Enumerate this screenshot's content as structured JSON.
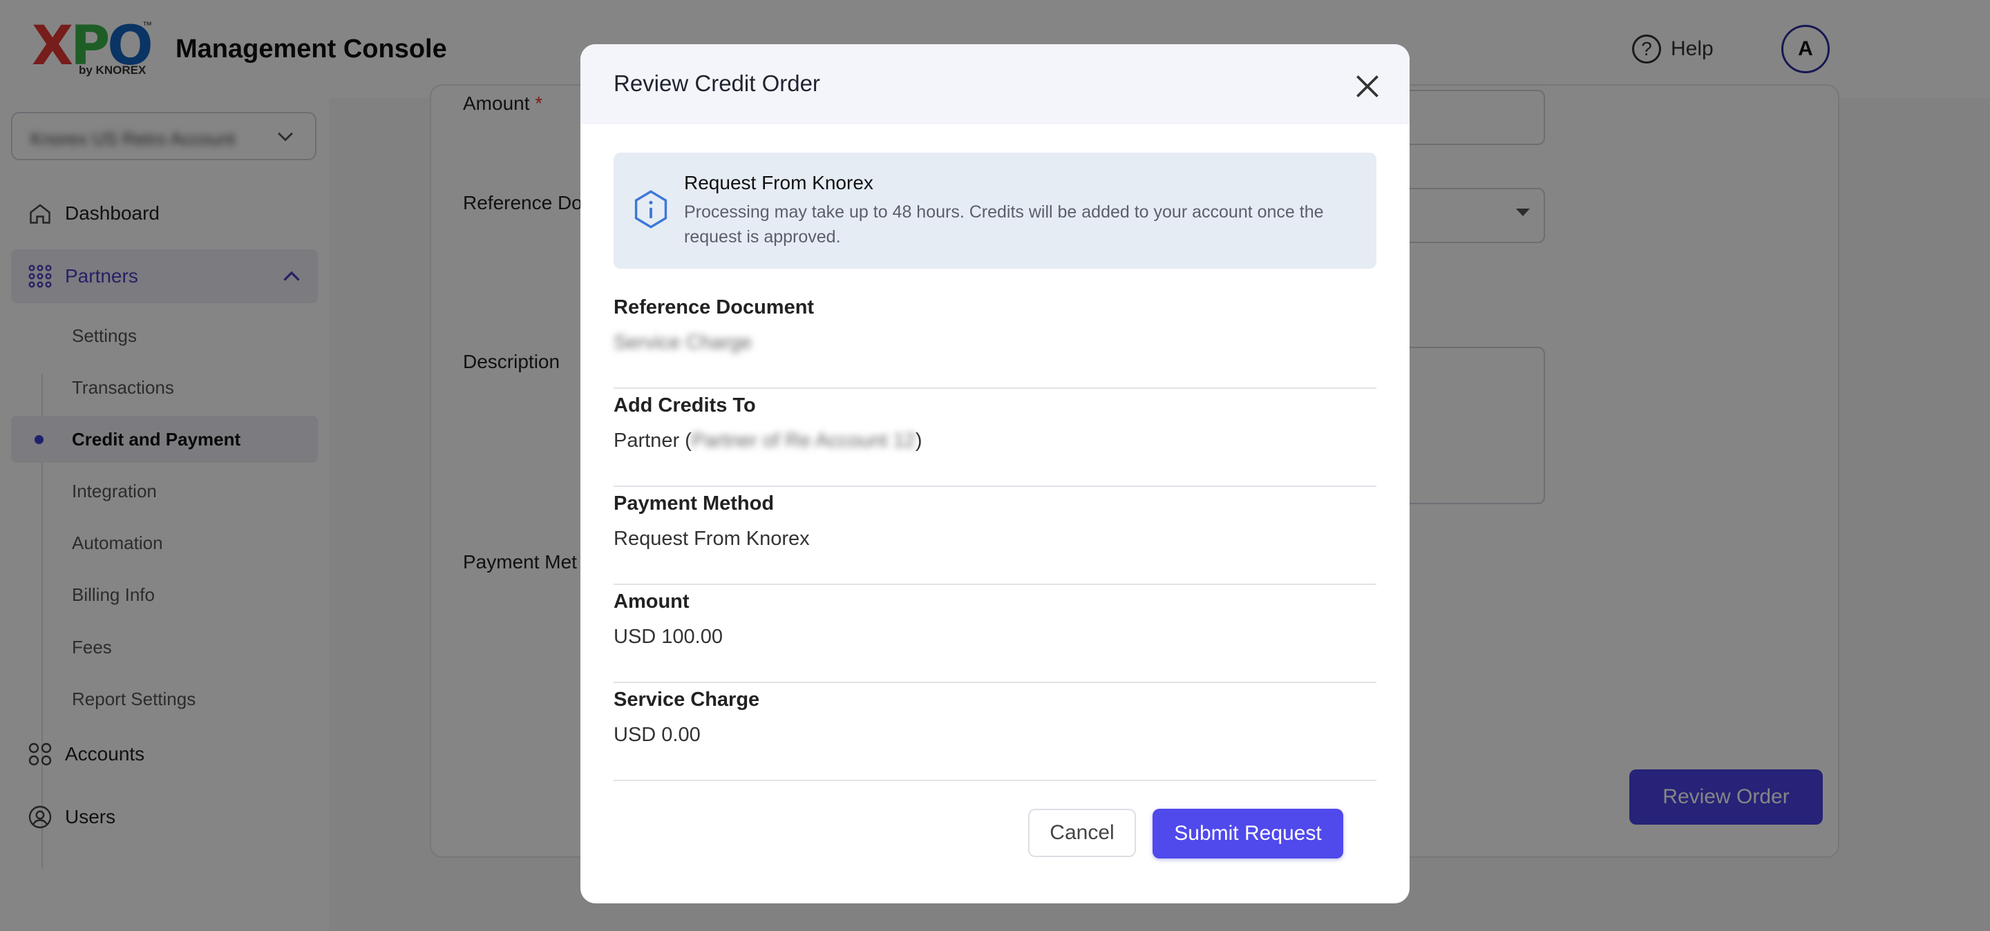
{
  "app": {
    "logo_main": "XPO",
    "logo_tm": "™",
    "logo_sub": "by KNOREX",
    "title": "Management Console",
    "help_label": "Help",
    "avatar_initial": "A"
  },
  "sidebar": {
    "account_select_value": "Knorex US Retro Account",
    "nav": {
      "dashboard": "Dashboard",
      "partners": "Partners",
      "accounts": "Accounts",
      "users": "Users"
    },
    "partners_sub": {
      "settings": "Settings",
      "transactions": "Transactions",
      "credit_payment": "Credit and Payment",
      "integration": "Integration",
      "automation": "Automation",
      "billing_info": "Billing Info",
      "fees": "Fees",
      "report_settings": "Report Settings"
    },
    "active_color": "#4a3fc0"
  },
  "form": {
    "amount_label": "Amount",
    "required_mark": "*",
    "reference_label": "Reference Do",
    "description_label": "Description",
    "payment_method_label": "Payment Met",
    "review_button": "Review Order"
  },
  "modal": {
    "title": "Review Credit Order",
    "info": {
      "title": "Request From Knorex",
      "description": "Processing may take up to 48 hours. Credits will be added to your account once the request is approved."
    },
    "details": {
      "reference_document": {
        "label": "Reference Document",
        "value": "Service Charge"
      },
      "add_credits_to": {
        "label": "Add Credits To",
        "prefix": "Partner (",
        "account": "Partner of Re Account 12",
        "suffix": ")"
      },
      "payment_method": {
        "label": "Payment Method",
        "value": "Request From Knorex"
      },
      "amount": {
        "label": "Amount",
        "value": "USD 100.00"
      },
      "service_charge": {
        "label": "Service Charge",
        "value": "USD 0.00"
      }
    },
    "cancel_label": "Cancel",
    "submit_label": "Submit Request",
    "accent_color": "#5049ec"
  }
}
